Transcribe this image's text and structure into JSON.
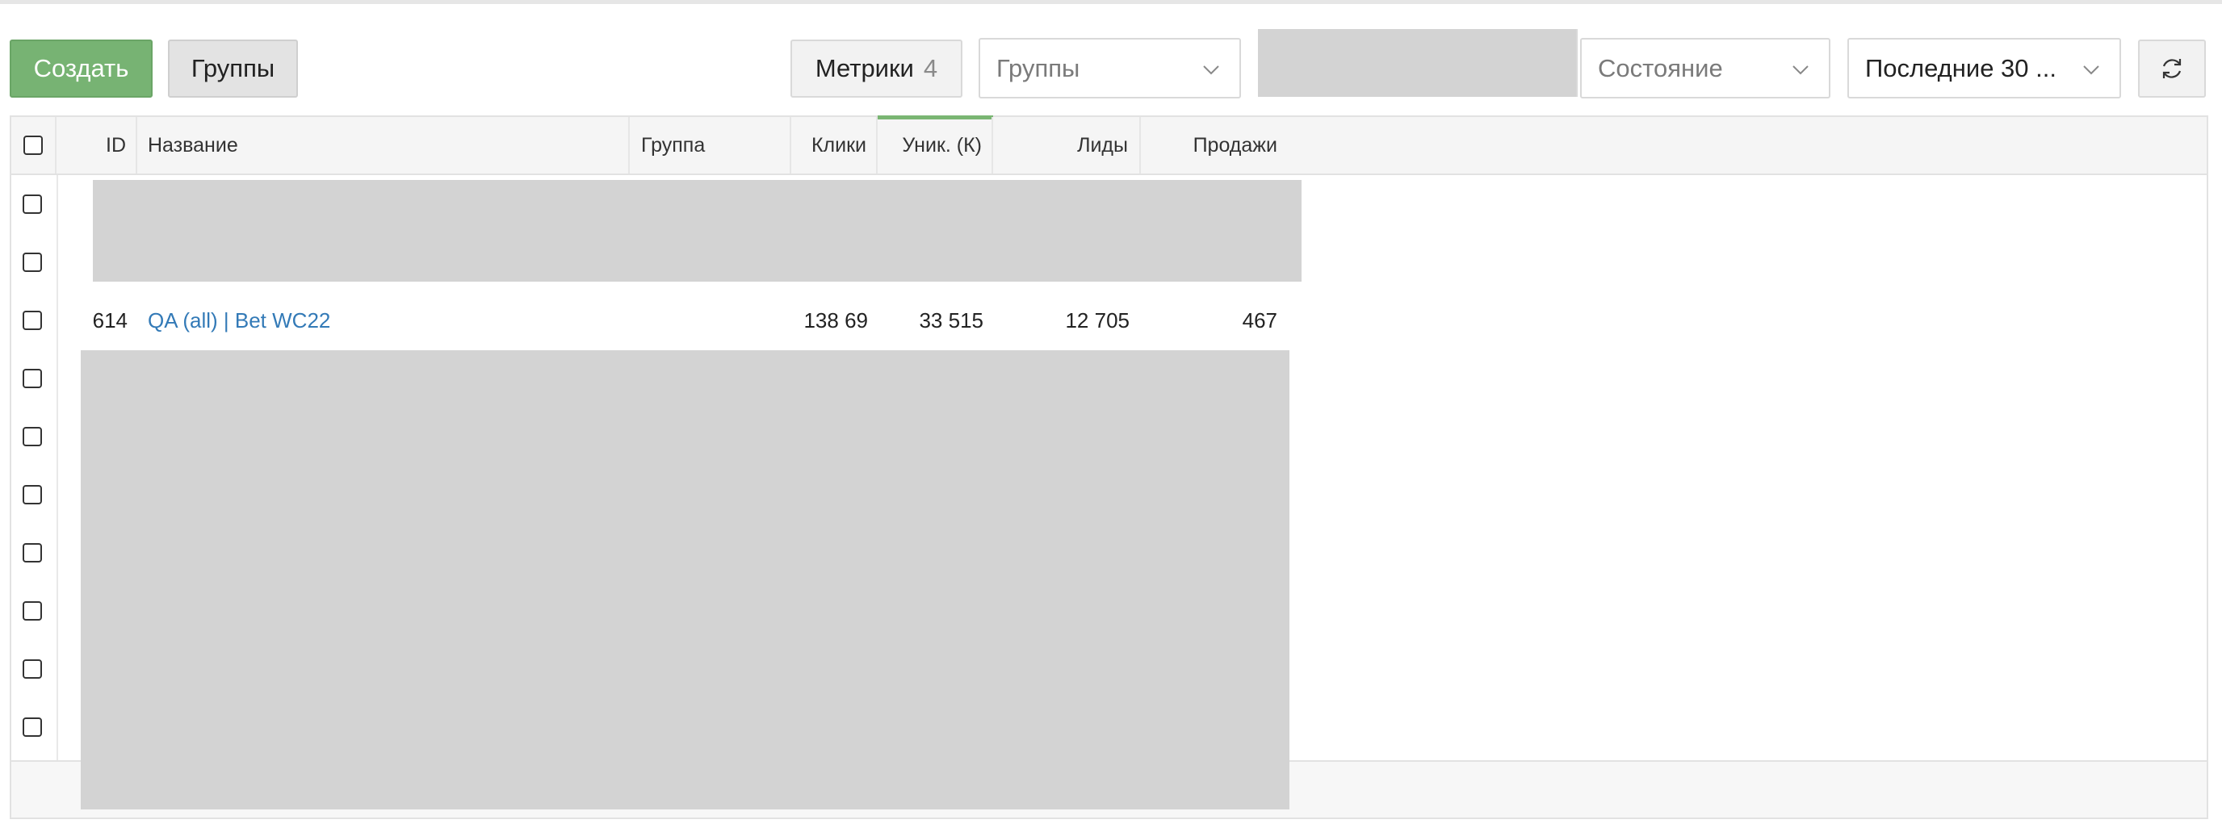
{
  "toolbar": {
    "create_label": "Создать",
    "groups_label": "Группы",
    "metrics_label": "Метрики",
    "metrics_count": "4",
    "groups_select": "Группы",
    "state_select": "Состояние",
    "period_select": "Последние 30 ..."
  },
  "table": {
    "columns": {
      "id": "ID",
      "name": "Название",
      "group": "Группа",
      "clicks": "Клики",
      "unique": "Уник. (К)",
      "leads": "Лиды",
      "sales": "Продажи"
    },
    "visible_row": {
      "id": "614",
      "name": "QA (all) | Bet WC22",
      "clicks": "138 69",
      "unique": "33 515",
      "leads": "12 705",
      "sales": "467"
    },
    "sorted_column": "Уник. (К)",
    "row_count": 10
  },
  "colors": {
    "accent_green": "#77b373",
    "link_blue": "#337ab7",
    "redaction_gray": "#d3d3d3"
  },
  "icons": {
    "select_arrow": "chevron-down-icon",
    "refresh": "refresh-icon"
  }
}
